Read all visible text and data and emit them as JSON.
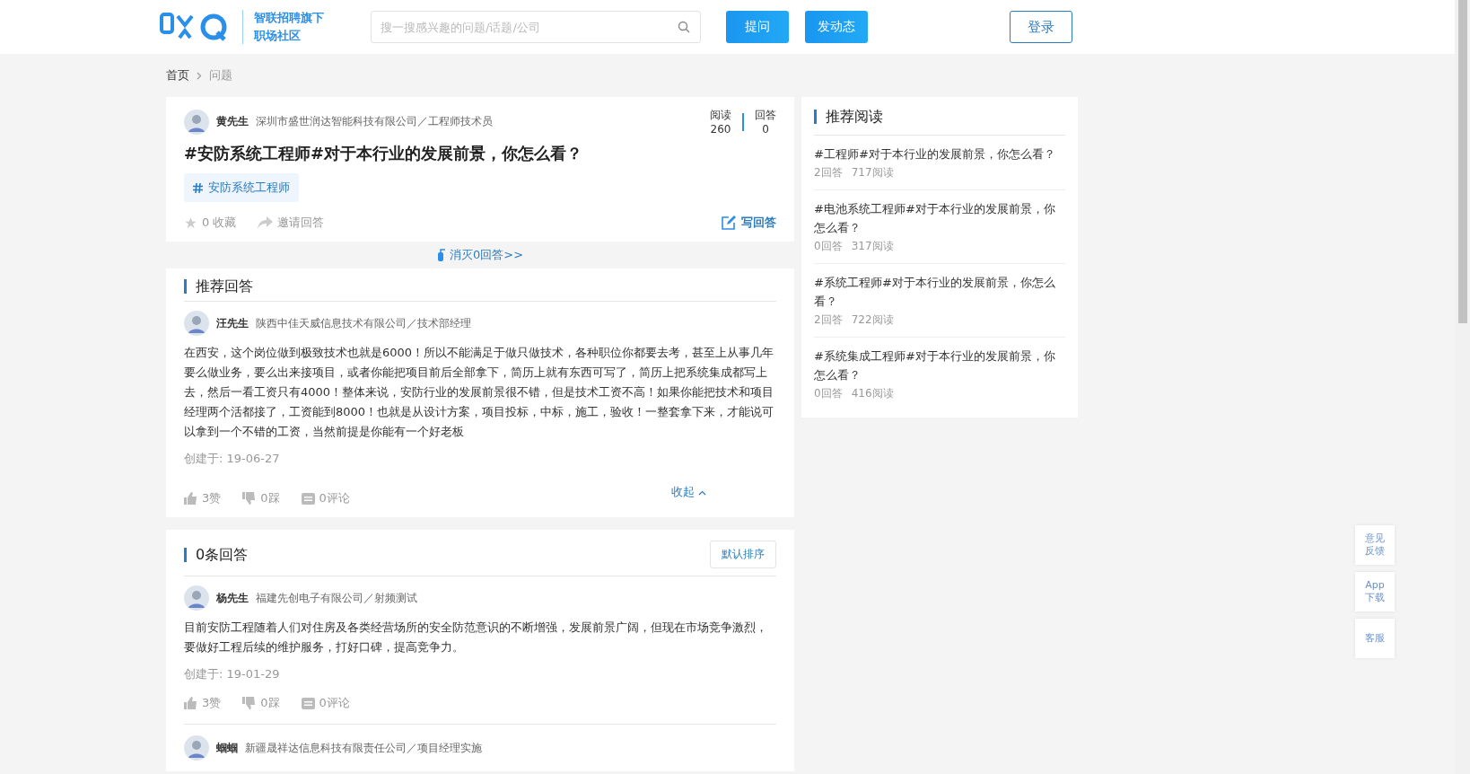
{
  "header": {
    "brand_line1": "智联招聘旗下",
    "brand_line2": "职场社区",
    "search": {
      "placeholder": "搜一搜感兴趣的问题/话题/公司"
    },
    "ask_button": "提问",
    "post_button": "发动态",
    "login_button": "登录"
  },
  "breadcrumb": [
    "首页",
    "问题"
  ],
  "question": {
    "author": "黄先生",
    "author_info": "深圳市盛世润达智能科技有限公司／工程师技术员",
    "stats": [
      {
        "label": "阅读",
        "value": "260"
      },
      {
        "label": "回答",
        "value": "0"
      }
    ],
    "title": "#安防系统工程师#对于本行业的发展前景，你怎么看？",
    "tag": "安防系统工程师",
    "favorite": "0 收藏",
    "invite": "邀请回答",
    "write": "写回答"
  },
  "eliminate_link": "消灭0回答>>",
  "recommended_answer": {
    "heading": "推荐回答",
    "author": "汪先生",
    "author_info": "陕西中佳天威信息技术有限公司／技术部经理",
    "text": "在西安，这个岗位做到极致技术也就是6000！所以不能满足于做只做技术，各种职位你都要去考，甚至上从事几年要么做业务，要么出来接项目，或者你能把项目前后全部拿下，简历上就有东西可写了，简历上把系统集成都写上去，然后一看工资只有4000！整体来说，安防行业的发展前景很不错，但是技术工资不高！如果你能把技术和项目经理两个活都接了，工资能到8000！也就是从设计方案，项目投标，中标，施工，验收！一整套拿下来，才能说可以拿到一个不错的工资，当然前提是你能有一个好老板",
    "created": "创建于: 19-06-27",
    "likes": "3赞",
    "dislikes": "0踩",
    "comments": "0评论",
    "collapse": "收起"
  },
  "answers": {
    "heading": "0条回答",
    "sort_button": "默认排序",
    "items": [
      {
        "author": "杨先生",
        "author_info": "福建先创电子有限公司／射频测试",
        "text": "目前安防工程随着人们对住房及各类经营场所的安全防范意识的不断增强，发展前景广阔，但现在市场竞争激烈，要做好工程后续的维护服务，打好口碑，提高竞争力。",
        "created": "创建于: 19-01-29",
        "likes": "3赞",
        "dislikes": "0踩",
        "comments": "0评论"
      },
      {
        "author": "蝈蝈",
        "author_info": "新疆晟祥达信息科技有限责任公司／项目经理实施"
      }
    ]
  },
  "sidebar": {
    "heading": "推荐阅读",
    "items": [
      {
        "title": "#工程师#对于本行业的发展前景，你怎么看？",
        "answers": "2回答",
        "reads": "717阅读"
      },
      {
        "title": "#电池系统工程师#对于本行业的发展前景，你怎么看？",
        "answers": "0回答",
        "reads": "317阅读"
      },
      {
        "title": "#系统工程师#对于本行业的发展前景，你怎么看？",
        "answers": "2回答",
        "reads": "722阅读"
      },
      {
        "title": "#系统集成工程师#对于本行业的发展前景，你怎么看？",
        "answers": "0回答",
        "reads": "416阅读"
      }
    ]
  },
  "floating_buttons": [
    "意见反馈",
    "App下载",
    "客服"
  ]
}
